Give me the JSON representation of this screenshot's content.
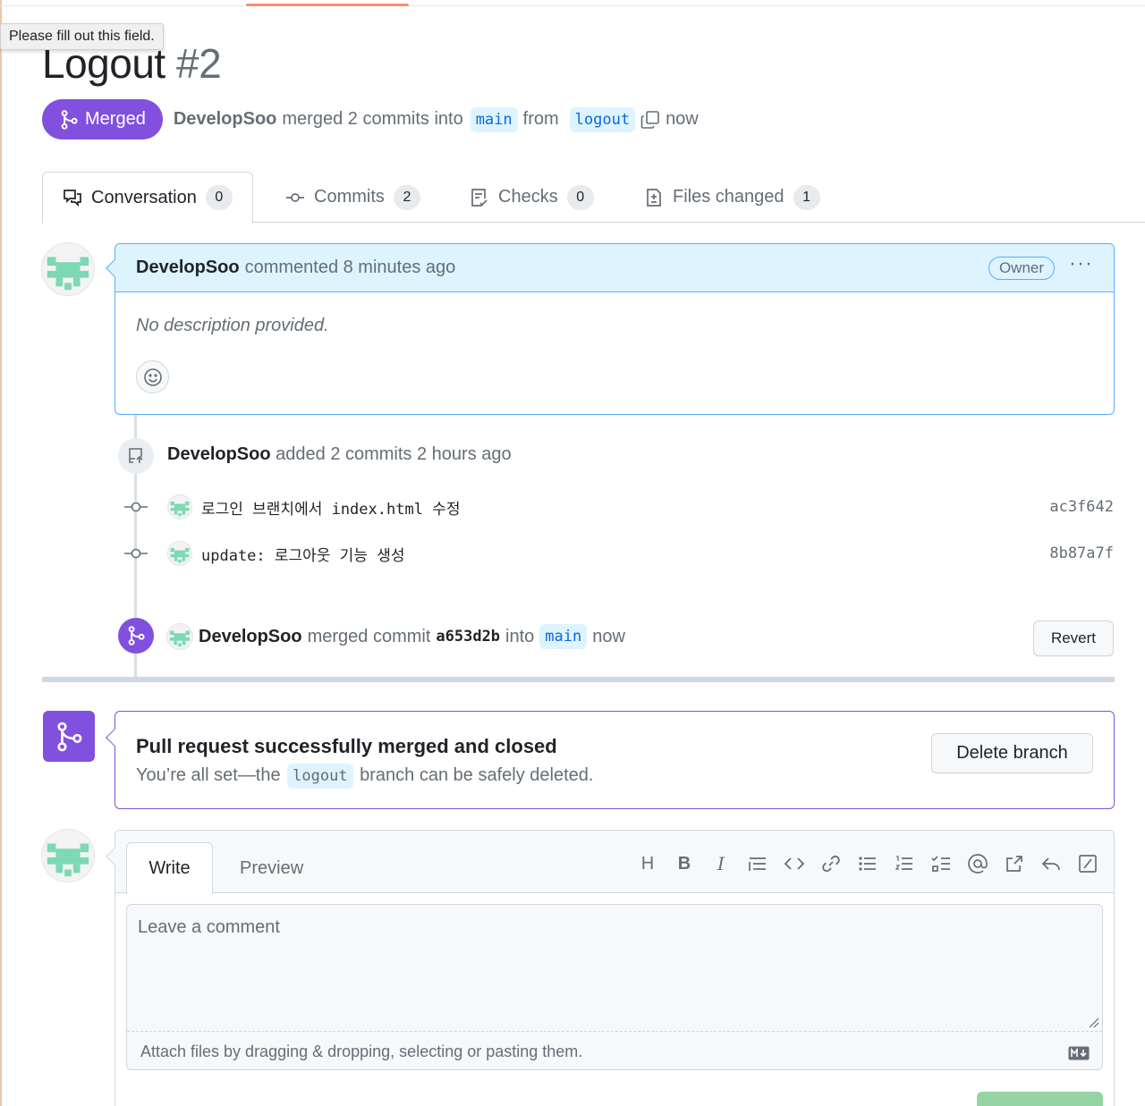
{
  "tooltip": "Please fill out this field.",
  "pr": {
    "title": "Logout",
    "number": "#2",
    "status": "Merged",
    "author": "DevelopSoo",
    "summary_mid": "merged 2 commits into",
    "base_branch": "main",
    "from_word": "from",
    "head_branch": "logout",
    "time": "now"
  },
  "tabs": [
    {
      "label": "Conversation",
      "count": "0"
    },
    {
      "label": "Commits",
      "count": "2"
    },
    {
      "label": "Checks",
      "count": "0"
    },
    {
      "label": "Files changed",
      "count": "1"
    }
  ],
  "comment": {
    "author": "DevelopSoo",
    "action": "commented 8 minutes ago",
    "role": "Owner",
    "body": "No description provided."
  },
  "commits_event": {
    "author": "DevelopSoo",
    "action": "added 2 commits 2 hours ago",
    "commits": [
      {
        "message": "로그인 브랜치에서 index.html 수정",
        "sha": "ac3f642"
      },
      {
        "message": "update: 로그아웃 기능 생성",
        "sha": "8b87a7f"
      }
    ]
  },
  "merge_event": {
    "author": "DevelopSoo",
    "pre": "merged commit",
    "sha": "a653d2b",
    "into": "into",
    "branch": "main",
    "time": "now",
    "revert_label": "Revert"
  },
  "merged_box": {
    "title": "Pull request successfully merged and closed",
    "sub_pre": "You’re all set—the",
    "branch": "logout",
    "sub_post": "branch can be safely deleted.",
    "delete_label": "Delete branch"
  },
  "editor": {
    "write_tab": "Write",
    "preview_tab": "Preview",
    "placeholder": "Leave a comment",
    "attach_hint": "Attach files by dragging & dropping, selecting or pasting them.",
    "toolbar": [
      "heading-icon",
      "bold-icon",
      "italic-icon",
      "quote-icon",
      "code-icon",
      "link-icon",
      "bulleted-list-icon",
      "numbered-list-icon",
      "task-list-icon",
      "mention-icon",
      "reference-icon",
      "reply-icon",
      "slash-command-icon"
    ]
  },
  "colors": {
    "merged_purple": "#8250df",
    "link_blue": "#0969da",
    "comment_header_bg": "#ddf4ff",
    "accent_orange": "#fd8c73"
  }
}
